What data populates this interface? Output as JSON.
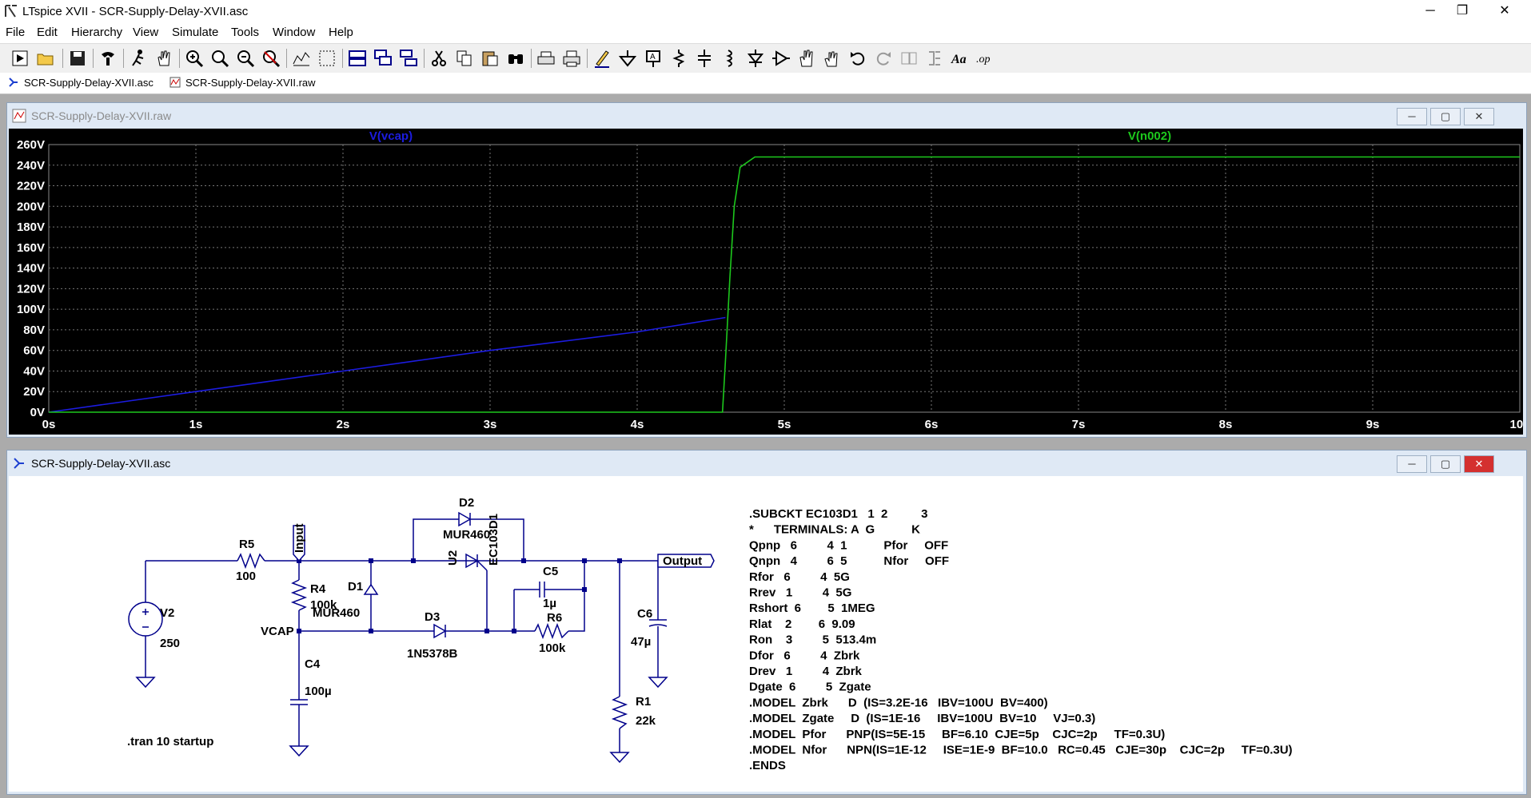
{
  "window": {
    "title": "LTspice XVII - SCR-Supply-Delay-XVII.asc",
    "controls": [
      "─",
      "❐",
      "✕"
    ]
  },
  "menu": [
    "File",
    "Edit",
    "Hierarchy",
    "View",
    "Simulate",
    "Tools",
    "Window",
    "Help"
  ],
  "toolbar_icons": [
    "run-icon",
    "open-icon",
    "save-icon",
    "control-panel-icon",
    "run-cursor-icon",
    "pan-icon",
    "zoom-in-icon",
    "zoom-area-icon",
    "zoom-out-icon",
    "zoom-cancel-icon",
    "autorange-icon",
    "fit-icon",
    "tile-horizontal-icon",
    "cascade-icon",
    "tile-vertical-icon",
    "cut-icon",
    "copy-icon",
    "paste-icon",
    "find-icon",
    "print-setup-icon",
    "print-icon",
    "pencil-icon",
    "ground-icon",
    "label-icon",
    "resistor-icon",
    "capacitor-icon",
    "inductor-icon",
    "diode-icon",
    "component-icon",
    "move-icon",
    "drag-icon",
    "undo-icon",
    "redo-icon",
    "rotate-icon",
    "mirror-icon",
    "text-icon",
    "spice-directive-icon"
  ],
  "tabs": [
    {
      "label": "SCR-Supply-Delay-XVII.asc",
      "icon": "schematic-icon"
    },
    {
      "label": "SCR-Supply-Delay-XVII.raw",
      "icon": "waveform-icon"
    }
  ],
  "plot_window": {
    "title": "SCR-Supply-Delay-XVII.raw",
    "controls": [
      "─",
      "▢",
      "✕"
    ],
    "trace_labels": [
      "V(vcap)",
      "V(n002)"
    ]
  },
  "chart_data": {
    "type": "line",
    "xlabel": "",
    "ylabel": "",
    "xlim": [
      0,
      10
    ],
    "ylim": [
      0,
      260
    ],
    "x_ticks": [
      "0s",
      "1s",
      "2s",
      "3s",
      "4s",
      "5s",
      "6s",
      "7s",
      "8s",
      "9s",
      "10s"
    ],
    "y_ticks": [
      "0V",
      "20V",
      "40V",
      "60V",
      "80V",
      "100V",
      "120V",
      "140V",
      "160V",
      "180V",
      "200V",
      "220V",
      "240V",
      "260V"
    ],
    "grid": true,
    "background": "#000000",
    "series": [
      {
        "name": "V(vcap)",
        "color": "#1c1ce0",
        "x": [
          0,
          1,
          2,
          3,
          4,
          4.6
        ],
        "y": [
          0,
          20,
          40,
          60,
          78,
          92
        ]
      },
      {
        "name": "V(n002)",
        "color": "#1dc81d",
        "x": [
          0,
          4.58,
          4.6,
          4.63,
          4.66,
          4.7,
          4.8,
          10
        ],
        "y": [
          0,
          0,
          50,
          130,
          200,
          238,
          248,
          248
        ]
      }
    ]
  },
  "schematic_window": {
    "title": "SCR-Supply-Delay-XVII.asc",
    "controls": [
      "─",
      "▢",
      "✕"
    ],
    "labels": {
      "v2": "V2",
      "v2_val": "250",
      "r5": "R5",
      "r5_val": "100",
      "input": "Input",
      "r4": "R4",
      "r4_val": "100k",
      "d1": "D1",
      "d1_val": "MUR460",
      "vcap": "VCAP",
      "c4": "C4",
      "c4_val": "100µ",
      "d2": "D2",
      "d2_val": "MUR460",
      "u2": "U2",
      "u2_val": "EC103D1",
      "d3": "D3",
      "d3_val": "1N5378B",
      "c5": "C5",
      "c5_val": "1µ",
      "r6": "R6",
      "r6_val": "100k",
      "output": "Output",
      "c6": "C6",
      "c6_val": "47µ",
      "r1": "R1",
      "r1_val": "22k",
      "tran": ".tran 10 startup"
    },
    "netlist": [
      ".SUBCKT EC103D1   1  2          3",
      "*      TERMINALS: A  G           K",
      "Qpnp   6         4  1           Pfor     OFF",
      "Qnpn   4         6  5           Nfor     OFF",
      "Rfor   6         4  5G",
      "Rrev   1         4  5G",
      "Rshort  6        5  1MEG",
      "Rlat    2        6  9.09",
      "Ron    3         5  513.4m",
      "Dfor   6         4  Zbrk",
      "Drev   1         4  Zbrk",
      "Dgate  6         5  Zgate",
      ".MODEL  Zbrk      D  (IS=3.2E-16   IBV=100U  BV=400)",
      ".MODEL  Zgate     D  (IS=1E-16     IBV=100U  BV=10     VJ=0.3)",
      ".MODEL  Pfor      PNP(IS=5E-15     BF=6.10  CJE=5p    CJC=2p     TF=0.3U)",
      ".MODEL  Nfor      NPN(IS=1E-12     ISE=1E-9  BF=10.0   RC=0.45   CJE=30p    CJC=2p     TF=0.3U)",
      ".ENDS"
    ]
  }
}
